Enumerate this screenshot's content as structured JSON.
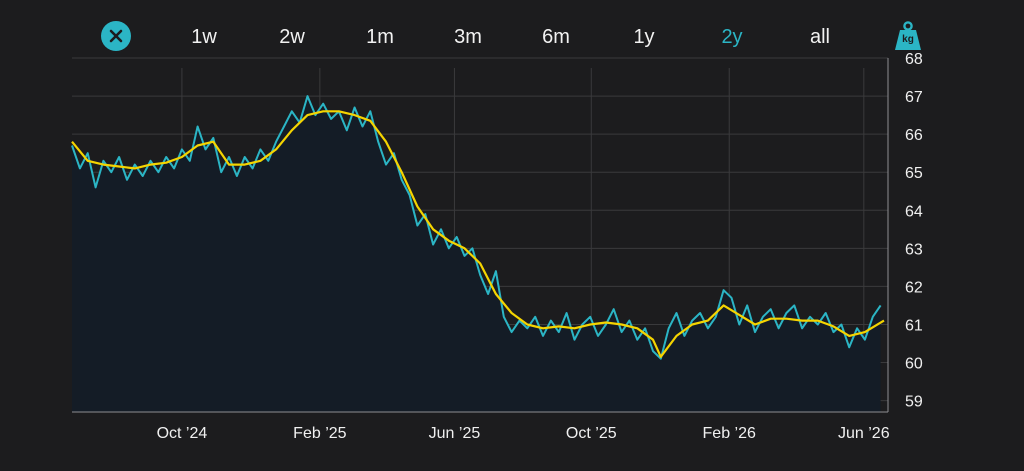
{
  "toolbar": {
    "close_icon": "close-icon",
    "tabs": [
      {
        "label": "1w",
        "active": false
      },
      {
        "label": "2w",
        "active": false
      },
      {
        "label": "1m",
        "active": false
      },
      {
        "label": "3m",
        "active": false
      },
      {
        "label": "6m",
        "active": false
      },
      {
        "label": "1y",
        "active": false
      },
      {
        "label": "2y",
        "active": true
      },
      {
        "label": "all",
        "active": false
      }
    ],
    "unit_icon": "weight-icon",
    "unit_label": "kg"
  },
  "colors": {
    "background": "#1c1c1e",
    "accent": "#2bb5c5",
    "raw_series": "#2bb5c5",
    "trend_series": "#f5d400",
    "grid": "#3a3a3c",
    "area_fill": "#141c26"
  },
  "chart_data": {
    "type": "line",
    "title": "",
    "xlabel": "",
    "ylabel": "",
    "ylim": [
      58.7,
      68
    ],
    "y_ticks": [
      59,
      60,
      61,
      62,
      63,
      64,
      65,
      66,
      67,
      68
    ],
    "y_axis_side": "right",
    "x_range": [
      "2024-06-25",
      "2026-06-19"
    ],
    "x_ticks": [
      {
        "label": "Oct ’24",
        "date": "2024-10-01"
      },
      {
        "label": "Feb ’25",
        "date": "2025-02-01"
      },
      {
        "label": "Jun ’25",
        "date": "2025-06-01"
      },
      {
        "label": "Oct ’25",
        "date": "2025-10-01"
      },
      {
        "label": "Feb ’26",
        "date": "2026-02-01"
      },
      {
        "label": "Jun ’26",
        "date": "2026-06-01"
      }
    ],
    "grid": true,
    "series": [
      {
        "style": "raw",
        "points": [
          [
            "2024-06-25",
            65.7
          ],
          [
            "2024-07-02",
            65.1
          ],
          [
            "2024-07-09",
            65.5
          ],
          [
            "2024-07-16",
            64.6
          ],
          [
            "2024-07-23",
            65.3
          ],
          [
            "2024-07-30",
            65.0
          ],
          [
            "2024-08-06",
            65.4
          ],
          [
            "2024-08-13",
            64.8
          ],
          [
            "2024-08-20",
            65.2
          ],
          [
            "2024-08-27",
            64.9
          ],
          [
            "2024-09-03",
            65.3
          ],
          [
            "2024-09-10",
            65.0
          ],
          [
            "2024-09-17",
            65.4
          ],
          [
            "2024-09-24",
            65.1
          ],
          [
            "2024-10-01",
            65.6
          ],
          [
            "2024-10-08",
            65.3
          ],
          [
            "2024-10-15",
            66.2
          ],
          [
            "2024-10-22",
            65.6
          ],
          [
            "2024-10-29",
            65.9
          ],
          [
            "2024-11-05",
            65.0
          ],
          [
            "2024-11-12",
            65.4
          ],
          [
            "2024-11-19",
            64.9
          ],
          [
            "2024-11-26",
            65.4
          ],
          [
            "2024-12-03",
            65.1
          ],
          [
            "2024-12-10",
            65.6
          ],
          [
            "2024-12-17",
            65.3
          ],
          [
            "2024-12-24",
            65.8
          ],
          [
            "2024-12-31",
            66.2
          ],
          [
            "2025-01-07",
            66.6
          ],
          [
            "2025-01-14",
            66.3
          ],
          [
            "2025-01-21",
            67.0
          ],
          [
            "2025-01-28",
            66.5
          ],
          [
            "2025-02-04",
            66.8
          ],
          [
            "2025-02-11",
            66.4
          ],
          [
            "2025-02-18",
            66.6
          ],
          [
            "2025-02-25",
            66.1
          ],
          [
            "2025-03-04",
            66.7
          ],
          [
            "2025-03-11",
            66.2
          ],
          [
            "2025-03-18",
            66.6
          ],
          [
            "2025-03-25",
            65.8
          ],
          [
            "2025-04-01",
            65.2
          ],
          [
            "2025-04-08",
            65.5
          ],
          [
            "2025-04-15",
            64.8
          ],
          [
            "2025-04-22",
            64.4
          ],
          [
            "2025-04-29",
            63.6
          ],
          [
            "2025-05-06",
            63.9
          ],
          [
            "2025-05-13",
            63.1
          ],
          [
            "2025-05-20",
            63.5
          ],
          [
            "2025-05-27",
            63.0
          ],
          [
            "2025-06-03",
            63.3
          ],
          [
            "2025-06-10",
            62.8
          ],
          [
            "2025-06-17",
            63.0
          ],
          [
            "2025-06-24",
            62.3
          ],
          [
            "2025-07-01",
            61.8
          ],
          [
            "2025-07-08",
            62.4
          ],
          [
            "2025-07-15",
            61.2
          ],
          [
            "2025-07-22",
            60.8
          ],
          [
            "2025-07-29",
            61.1
          ],
          [
            "2025-08-05",
            60.9
          ],
          [
            "2025-08-12",
            61.2
          ],
          [
            "2025-08-19",
            60.7
          ],
          [
            "2025-08-26",
            61.1
          ],
          [
            "2025-09-02",
            60.8
          ],
          [
            "2025-09-09",
            61.3
          ],
          [
            "2025-09-16",
            60.6
          ],
          [
            "2025-09-23",
            61.0
          ],
          [
            "2025-09-30",
            61.2
          ],
          [
            "2025-10-07",
            60.7
          ],
          [
            "2025-10-14",
            61.0
          ],
          [
            "2025-10-21",
            61.4
          ],
          [
            "2025-10-28",
            60.8
          ],
          [
            "2025-11-04",
            61.1
          ],
          [
            "2025-11-11",
            60.6
          ],
          [
            "2025-11-18",
            60.9
          ],
          [
            "2025-11-25",
            60.3
          ],
          [
            "2025-12-02",
            60.1
          ],
          [
            "2025-12-09",
            60.9
          ],
          [
            "2025-12-16",
            61.3
          ],
          [
            "2025-12-23",
            60.7
          ],
          [
            "2025-12-30",
            61.1
          ],
          [
            "2026-01-06",
            61.3
          ],
          [
            "2026-01-13",
            60.9
          ],
          [
            "2026-01-20",
            61.2
          ],
          [
            "2026-01-27",
            61.9
          ],
          [
            "2026-02-03",
            61.7
          ],
          [
            "2026-02-10",
            61.0
          ],
          [
            "2026-02-17",
            61.5
          ],
          [
            "2026-02-24",
            60.8
          ],
          [
            "2026-03-03",
            61.2
          ],
          [
            "2026-03-10",
            61.4
          ],
          [
            "2026-03-17",
            60.9
          ],
          [
            "2026-03-24",
            61.3
          ],
          [
            "2026-03-31",
            61.5
          ],
          [
            "2026-04-07",
            60.9
          ],
          [
            "2026-04-14",
            61.2
          ],
          [
            "2026-04-21",
            61.0
          ],
          [
            "2026-04-28",
            61.3
          ],
          [
            "2026-05-05",
            60.8
          ],
          [
            "2026-05-12",
            61.0
          ],
          [
            "2026-05-19",
            60.4
          ],
          [
            "2026-05-26",
            60.9
          ],
          [
            "2026-06-02",
            60.6
          ],
          [
            "2026-06-09",
            61.2
          ],
          [
            "2026-06-16",
            61.5
          ]
        ]
      },
      {
        "style": "trend",
        "points": [
          [
            "2024-06-25",
            65.8
          ],
          [
            "2024-07-09",
            65.3
          ],
          [
            "2024-07-23",
            65.2
          ],
          [
            "2024-08-06",
            65.15
          ],
          [
            "2024-08-20",
            65.1
          ],
          [
            "2024-09-03",
            65.2
          ],
          [
            "2024-09-17",
            65.25
          ],
          [
            "2024-10-01",
            65.4
          ],
          [
            "2024-10-15",
            65.7
          ],
          [
            "2024-10-29",
            65.8
          ],
          [
            "2024-11-12",
            65.2
          ],
          [
            "2024-11-26",
            65.2
          ],
          [
            "2024-12-10",
            65.3
          ],
          [
            "2024-12-24",
            65.6
          ],
          [
            "2025-01-07",
            66.1
          ],
          [
            "2025-01-21",
            66.5
          ],
          [
            "2025-02-04",
            66.6
          ],
          [
            "2025-02-18",
            66.6
          ],
          [
            "2025-03-04",
            66.5
          ],
          [
            "2025-03-18",
            66.35
          ],
          [
            "2025-04-01",
            65.8
          ],
          [
            "2025-04-15",
            65.0
          ],
          [
            "2025-04-29",
            64.1
          ],
          [
            "2025-05-13",
            63.5
          ],
          [
            "2025-05-27",
            63.2
          ],
          [
            "2025-06-10",
            63.0
          ],
          [
            "2025-06-24",
            62.6
          ],
          [
            "2025-07-08",
            61.8
          ],
          [
            "2025-07-22",
            61.3
          ],
          [
            "2025-08-05",
            61.0
          ],
          [
            "2025-08-19",
            60.9
          ],
          [
            "2025-09-02",
            60.95
          ],
          [
            "2025-09-16",
            60.9
          ],
          [
            "2025-09-30",
            61.0
          ],
          [
            "2025-10-14",
            61.05
          ],
          [
            "2025-10-28",
            61.0
          ],
          [
            "2025-11-11",
            60.9
          ],
          [
            "2025-11-25",
            60.6
          ],
          [
            "2025-12-02",
            60.15
          ],
          [
            "2025-12-16",
            60.7
          ],
          [
            "2025-12-30",
            61.0
          ],
          [
            "2026-01-13",
            61.1
          ],
          [
            "2026-01-27",
            61.5
          ],
          [
            "2026-02-10",
            61.25
          ],
          [
            "2026-02-24",
            61.0
          ],
          [
            "2026-03-10",
            61.15
          ],
          [
            "2026-03-24",
            61.15
          ],
          [
            "2026-04-07",
            61.1
          ],
          [
            "2026-04-21",
            61.1
          ],
          [
            "2026-05-05",
            60.95
          ],
          [
            "2026-05-19",
            60.7
          ],
          [
            "2026-06-02",
            60.8
          ],
          [
            "2026-06-19",
            61.1
          ]
        ]
      }
    ]
  }
}
